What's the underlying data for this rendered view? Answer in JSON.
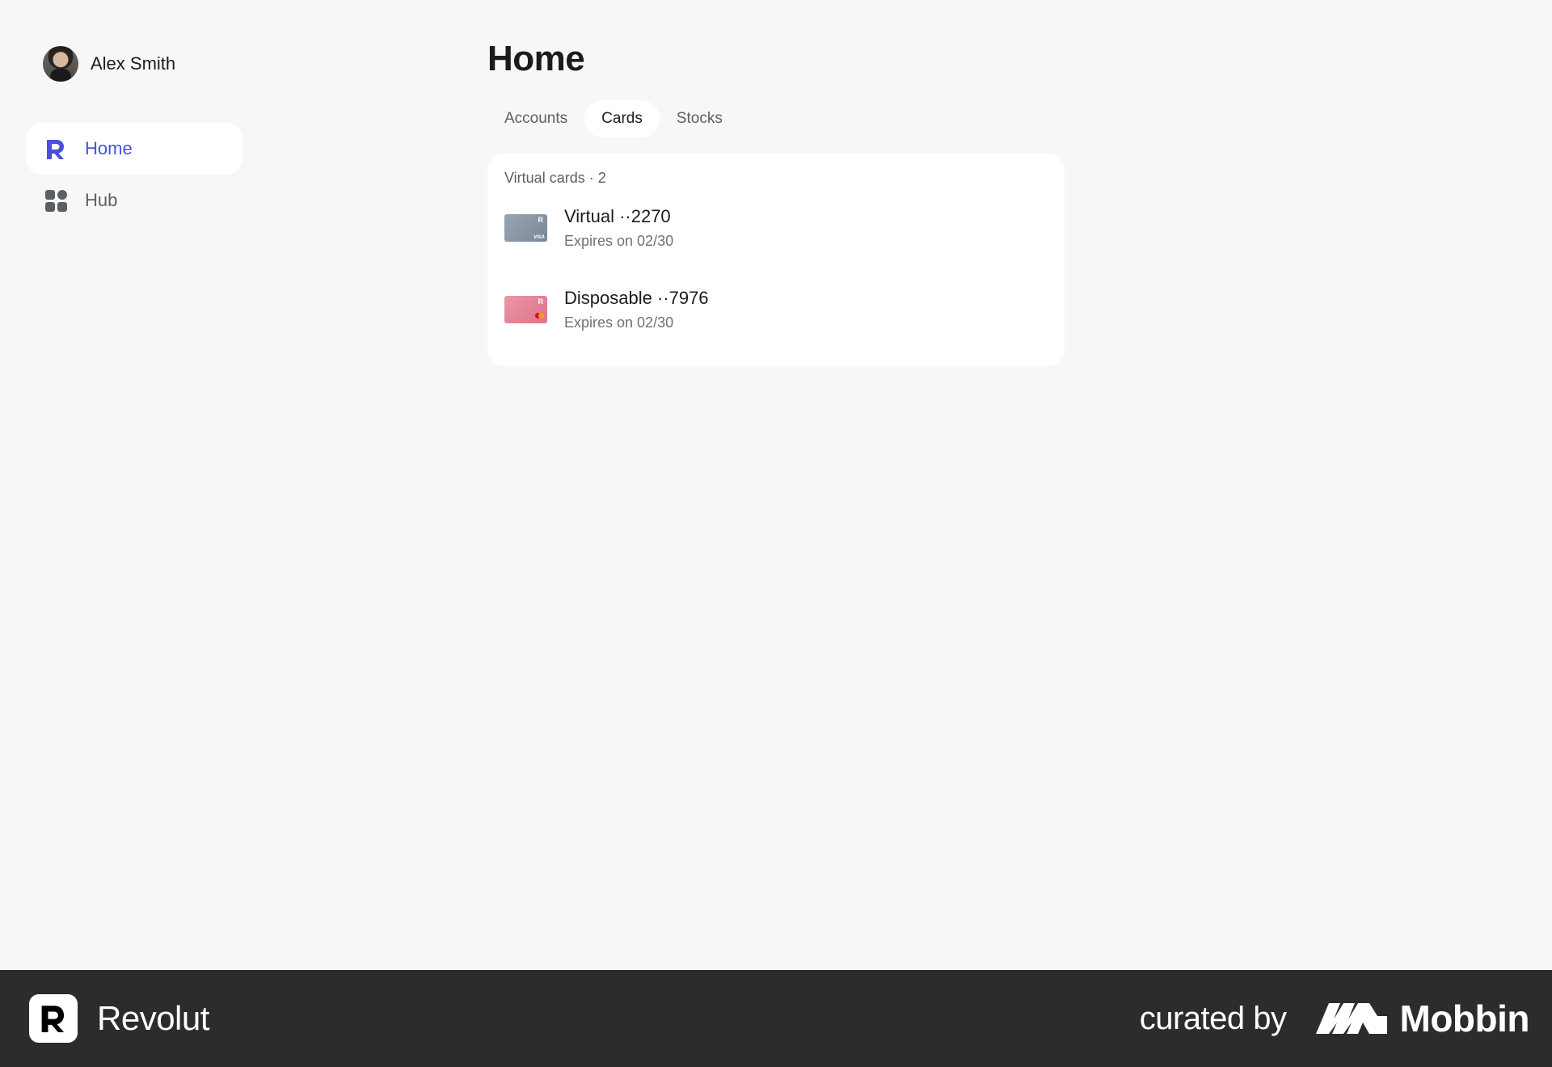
{
  "user": {
    "name": "Alex Smith"
  },
  "sidebar": {
    "items": [
      {
        "label": "Home",
        "icon": "revolut-logo-icon",
        "active": true
      },
      {
        "label": "Hub",
        "icon": "grid-apps-icon",
        "active": false
      }
    ]
  },
  "main": {
    "title": "Home",
    "tabs": [
      {
        "label": "Accounts",
        "active": false
      },
      {
        "label": "Cards",
        "active": true
      },
      {
        "label": "Stocks",
        "active": false
      }
    ],
    "panel": {
      "title": "Virtual cards · 2",
      "cards": [
        {
          "name": "Virtual ··2270",
          "expiry": "Expires on 02/30",
          "color": "#8a96a6",
          "network": "VISA"
        },
        {
          "name": "Disposable ··7976",
          "expiry": "Expires on 02/30",
          "color": "#e48598",
          "network": "mastercard"
        }
      ]
    }
  },
  "footer": {
    "brand": "Revolut",
    "curated_by": "curated by",
    "curator": "Mobbin"
  },
  "colors": {
    "accent": "#494fdf",
    "background": "#f7f7f7",
    "footer": "#2c2c2c"
  }
}
